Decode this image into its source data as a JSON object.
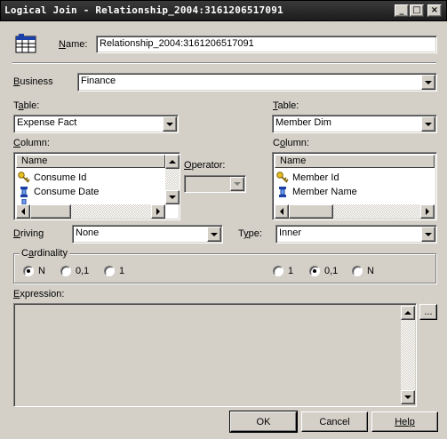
{
  "window": {
    "title": "Logical Join - Relationship_2004:3161206517091",
    "minimize_glyph": "_",
    "maximize_glyph": "□",
    "close_glyph": "×"
  },
  "name": {
    "label": "Name:",
    "value": "Relationship_2004:3161206517091"
  },
  "business": {
    "label": "Business",
    "value": "Finance"
  },
  "left_table": {
    "label": "Table:",
    "value": "Expense Fact",
    "column_label": "Column:",
    "header": "Name",
    "items": [
      {
        "label": "Consume Id",
        "icon": "key-icon"
      },
      {
        "label": "Consume Date",
        "icon": "column-icon"
      }
    ]
  },
  "operator": {
    "label": "Operator:",
    "value": ""
  },
  "right_table": {
    "label": "Table:",
    "value": "Member Dim",
    "column_label": "Column:",
    "header": "Name",
    "items": [
      {
        "label": "Member Id",
        "icon": "key-icon"
      },
      {
        "label": "Member Name",
        "icon": "column-icon"
      }
    ]
  },
  "driving": {
    "label": "Driving",
    "value": "None"
  },
  "type": {
    "label": "Type:",
    "value": "Inner"
  },
  "cardinality": {
    "label": "Cardinality",
    "left": [
      {
        "label": "N",
        "selected": true
      },
      {
        "label": "0,1",
        "selected": false
      },
      {
        "label": "1",
        "selected": false
      }
    ],
    "right": [
      {
        "label": "1",
        "selected": false
      },
      {
        "label": "0,1",
        "selected": true
      },
      {
        "label": "N",
        "selected": false
      }
    ]
  },
  "expression": {
    "label": "Expression:",
    "value": "",
    "builder_label": "..."
  },
  "buttons": {
    "ok": "OK",
    "cancel": "Cancel",
    "help": "Help"
  }
}
